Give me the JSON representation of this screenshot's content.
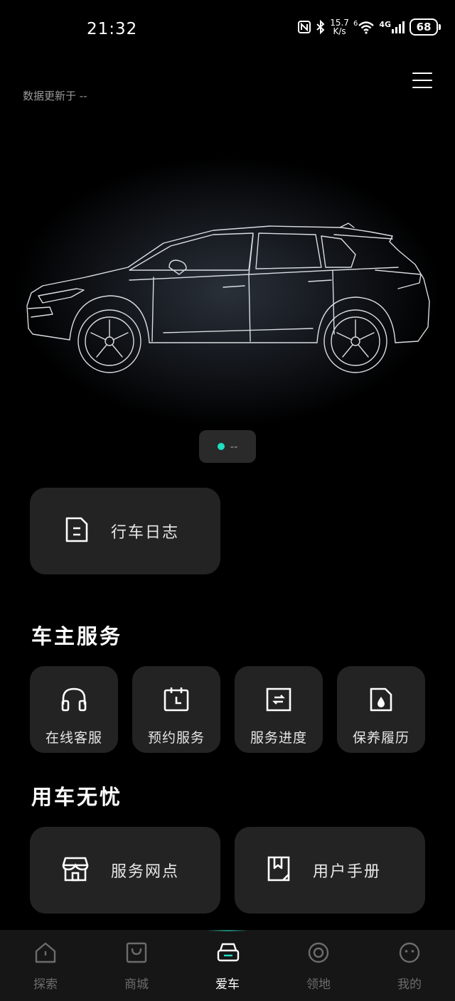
{
  "status_bar": {
    "time": "21:32",
    "net_speed_value": "15.7",
    "net_speed_unit": "K/s",
    "wifi_label": "6",
    "cell_label": "4G",
    "battery": "68"
  },
  "header": {
    "update_text": "数据更新于 --"
  },
  "vehicle_status": {
    "value": "--",
    "dot_color": "#1fe0c3"
  },
  "quick_card": {
    "drive_log": "行车日志"
  },
  "owner_services": {
    "title": "车主服务",
    "items": [
      {
        "label": "在线客服",
        "icon": "headset-icon"
      },
      {
        "label": "预约服务",
        "icon": "calendar-icon"
      },
      {
        "label": "服务进度",
        "icon": "progress-icon"
      },
      {
        "label": "保养履历",
        "icon": "maintenance-icon"
      }
    ]
  },
  "worry_free": {
    "title": "用车无忧",
    "items": [
      {
        "label": "服务网点",
        "icon": "store-icon"
      },
      {
        "label": "用户手册",
        "icon": "manual-icon"
      }
    ]
  },
  "tab_bar": {
    "tabs": [
      {
        "label": "探索",
        "icon": "explore-icon"
      },
      {
        "label": "商城",
        "icon": "shop-icon"
      },
      {
        "label": "爱车",
        "icon": "car-icon"
      },
      {
        "label": "领地",
        "icon": "territory-icon"
      },
      {
        "label": "我的",
        "icon": "profile-icon"
      }
    ],
    "active": "爱车"
  },
  "colors": {
    "accent": "#1fe0c3",
    "background": "#000000",
    "card": "#232323",
    "tab_bar": "#161616"
  }
}
